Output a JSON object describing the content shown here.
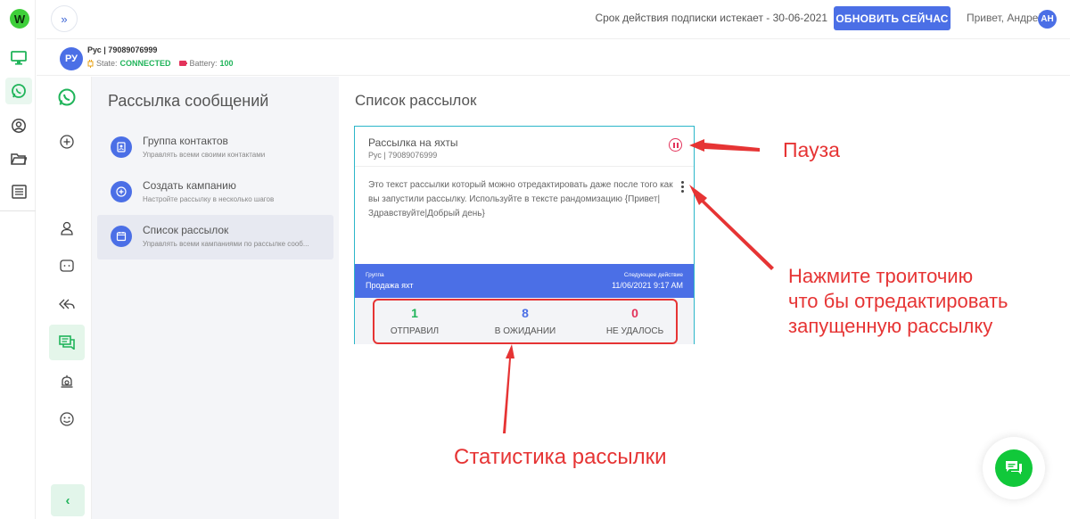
{
  "app": {
    "logo_letter": "W"
  },
  "header": {
    "subscription_text": "Срок действия подписки истекает - 30-06-2021",
    "renew_label": "ОБНОВИТЬ СЕЙЧАС",
    "greeting": "Привет, Андрей",
    "user_initials": "АН"
  },
  "account": {
    "initials": "РУ",
    "name": "Рус | 79089076999",
    "state_label": "State:",
    "state_value": "CONNECTED",
    "battery_label": "Battery:",
    "battery_value": "100"
  },
  "section": {
    "title": "Рассылка сообщений",
    "items": [
      {
        "title": "Группа контактов",
        "subtitle": "Управлять всеми своими контактами",
        "icon": "contacts-icon",
        "active": false
      },
      {
        "title": "Создать кампанию",
        "subtitle": "Настройте рассылку в несколько шагов",
        "icon": "plus-icon",
        "active": false
      },
      {
        "title": "Список рассылок",
        "subtitle": "Управлять всеми кампаниями по рассылке сооб...",
        "icon": "calendar-icon",
        "active": true
      }
    ]
  },
  "main": {
    "title": "Список рассылок",
    "campaign": {
      "title": "Рассылка на яхты",
      "subtitle": "Рус | 79089076999",
      "text": "Это текст рассылки который можно отредактировать даже после того как вы запустили рассылку. Используйте в тексте рандомизацию {Привет|Здравствуйте|Добрый день}",
      "group_label": "Группа",
      "group_value": "Продажа яхт",
      "next_label": "Следующее действие",
      "next_value": "11/06/2021 9:17 AM",
      "stats": [
        {
          "value": "1",
          "label": "ОТПРАВИЛ",
          "color": "#20b45a"
        },
        {
          "value": "8",
          "label": "В ОЖИДАНИИ",
          "color": "#4b6fe6"
        },
        {
          "value": "0",
          "label": "НЕ УДАЛОСЬ",
          "color": "#e3335b"
        }
      ]
    }
  },
  "annotations": {
    "pause": "Пауза",
    "edit_line1": "Нажмите троиточию",
    "edit_line2": "что бы отредактировать",
    "edit_line3": "запущенную рассылку",
    "stats": "Статистика рассылки"
  },
  "colors": {
    "accent": "#4b6fe6",
    "green": "#20b45a",
    "red": "#e63434",
    "card_border": "#2bb6c9"
  }
}
